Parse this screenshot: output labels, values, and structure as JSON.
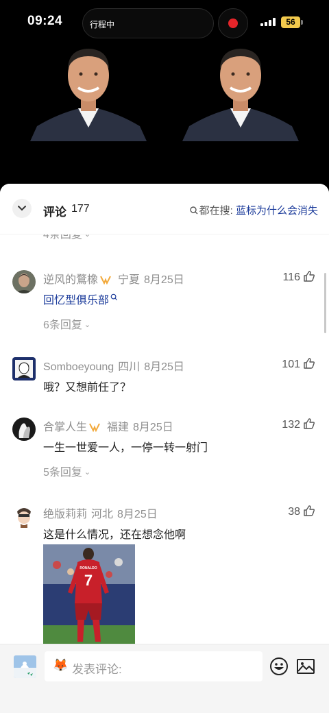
{
  "status": {
    "time": "09:24",
    "island_label": "行程中",
    "battery": "56"
  },
  "header": {
    "title": "评论",
    "count": "177",
    "search_prefix": "都在搜:",
    "search_hot": "蓝标为什么会消失"
  },
  "top_replies": "4条回复",
  "comments": [
    {
      "name": "逆风的鶩橡",
      "location": "宁夏",
      "date": "8月25日",
      "likes": "116",
      "text": "回忆型俱乐部",
      "replies": "6条回复"
    },
    {
      "name": "Somboeyoung",
      "location": "四川",
      "date": "8月25日",
      "likes": "101",
      "text": "哦？又想前任了？"
    },
    {
      "name": "合掌人生",
      "location": "福建",
      "date": "8月25日",
      "likes": "132",
      "text": "一生一世爱一人，一停一转一射门",
      "replies": "5条回复"
    },
    {
      "name": "绝版莉莉",
      "location": "河北",
      "date": "8月25日",
      "likes": "38",
      "text": "这是什么情况，还在想念他啊",
      "image_jersey": "RONALDO 7"
    }
  ],
  "input": {
    "placeholder": "发表评论:"
  },
  "colors": {
    "link": "#1a3a9a",
    "gold_badge": "#f2a93b",
    "record": "#e5252a"
  }
}
